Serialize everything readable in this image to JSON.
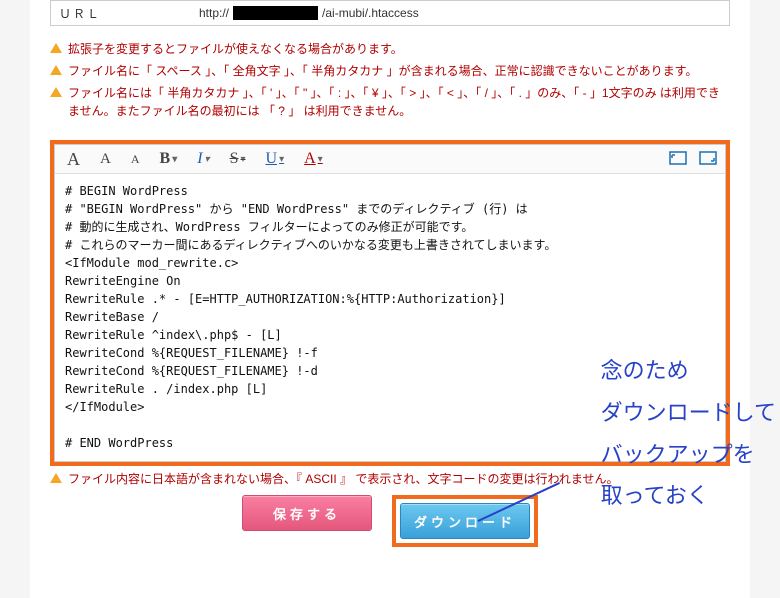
{
  "url": {
    "label": "ＵＲＬ",
    "prefix": "http://",
    "suffix": "/ai-mubi/.htaccess"
  },
  "warnings": {
    "w1": "拡張子を変更するとファイルが使えなくなる場合があります。",
    "w2": "ファイル名に「 スペース 」、「 全角文字 」、「 半角カタカナ 」が含まれる場合、正常に認識できないことがあります。",
    "w3": "ファイル名には「 半角カタカナ 」、「 ' 」、「 \" 」、「 : 」、「 ¥ 」、「 > 」、「 < 」、「 / 」、「 . 」のみ、「 - 」1文字のみ は利用できません。またファイル名の最初には 「 ? 」 は利用できません。",
    "post": "ファイル内容に日本語が含まれない場合、『 ASCII 』 で表示され、文字コードの変更は行われません。"
  },
  "toolbar": {
    "a1": "A",
    "a2": "A",
    "a3": "A",
    "bold": "B",
    "italic": "I",
    "strike": "S",
    "underline": "U",
    "color": "A"
  },
  "editor": {
    "content": "# BEGIN WordPress\n# \"BEGIN WordPress\" から \"END WordPress\" までのディレクティブ (行) は\n# 動的に生成され、WordPress フィルターによってのみ修正が可能です。\n# これらのマーカー間にあるディレクティブへのいかなる変更も上書きされてしまいます。\n<IfModule mod_rewrite.c>\nRewriteEngine On\nRewriteRule .* - [E=HTTP_AUTHORIZATION:%{HTTP:Authorization}]\nRewriteBase /\nRewriteRule ^index\\.php$ - [L]\nRewriteCond %{REQUEST_FILENAME} !-f\nRewriteCond %{REQUEST_FILENAME} !-d\nRewriteRule . /index.php [L]\n</IfModule>\n\n# END WordPress"
  },
  "buttons": {
    "save": "保存する",
    "download": "ダウンロード"
  },
  "annotation": "念のため\nダウンロードして\nバックアップを\n取っておく"
}
